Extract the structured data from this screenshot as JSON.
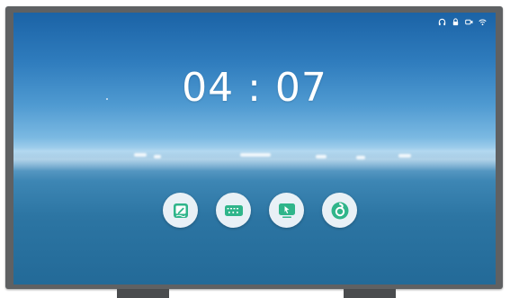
{
  "clock": {
    "time": "04 : 07"
  },
  "status_icons": [
    "headset-icon",
    "lock-icon",
    "camera-icon",
    "wifi-icon"
  ],
  "dock": {
    "apps": [
      {
        "icon": "whiteboard-pen-icon",
        "color": "#2fb58a"
      },
      {
        "icon": "keyboard-icon",
        "color": "#2fb58a"
      },
      {
        "icon": "screen-share-icon",
        "color": "#2fb58a"
      },
      {
        "icon": "browser-swirl-icon",
        "color": "#2fb58a"
      }
    ]
  },
  "colors": {
    "bezel": "#5f6163",
    "accent": "#2fb58a",
    "sky_top": "#1b63a6",
    "sea": "#236a98"
  }
}
